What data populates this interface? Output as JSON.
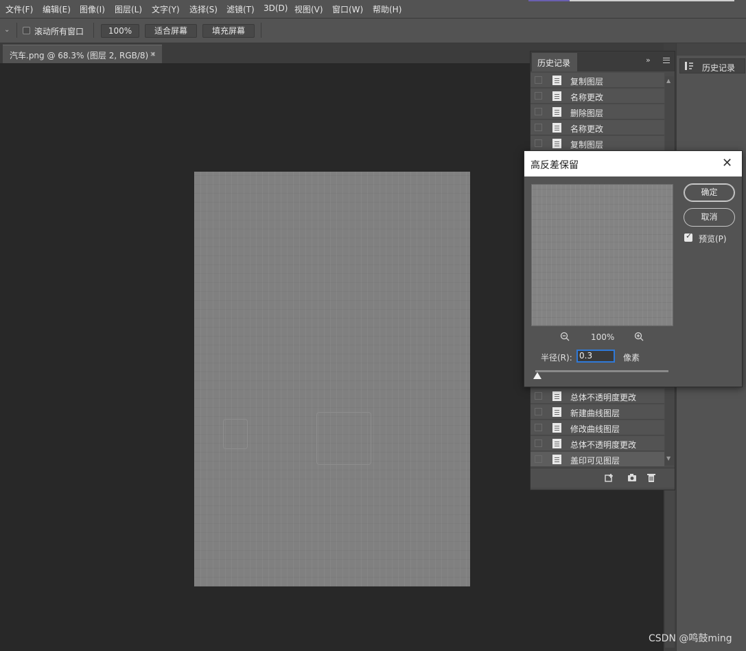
{
  "menubar": {
    "items": [
      "文件(F)",
      "编辑(E)",
      "图像(I)",
      "图层(L)",
      "文字(Y)",
      "选择(S)",
      "滤镜(T)",
      "3D(D)",
      "视图(V)",
      "窗口(W)",
      "帮助(H)"
    ]
  },
  "options": {
    "scroll_all_label": "滚动所有窗口",
    "zoom_button": "100%",
    "fit_screen": "适合屏幕",
    "fill_screen": "填充屏幕"
  },
  "document": {
    "tab_title": "汽车.png @ 68.3% (图层 2, RGB/8) *",
    "close_glyph": "×"
  },
  "history_panel": {
    "tab_label": "历史记录",
    "expand_glyph": "»",
    "top_items": [
      "复制图层",
      "名称更改",
      "删除图层",
      "名称更改",
      "复制图层"
    ],
    "bottom_items": [
      "总体不透明度更改",
      "新建曲线图层",
      "修改曲线图层",
      "总体不透明度更改",
      "盖印可见图层"
    ],
    "selected_item": "盖印可见图层"
  },
  "dock": {
    "history_label": "历史记录"
  },
  "dialog": {
    "title": "高反差保留",
    "close_glyph": "✕",
    "ok_label": "确定",
    "cancel_label": "取消",
    "preview_label": "预览(P)",
    "preview_checked": true,
    "zoom_percent": "100%",
    "radius_label": "半径(R):",
    "radius_value": "0.3",
    "radius_unit": "像素"
  },
  "watermark": "CSDN @鸣鼓ming",
  "colors": {
    "panel": "#535353",
    "canvas": "#282828",
    "accent_focus": "#2f79d8"
  }
}
